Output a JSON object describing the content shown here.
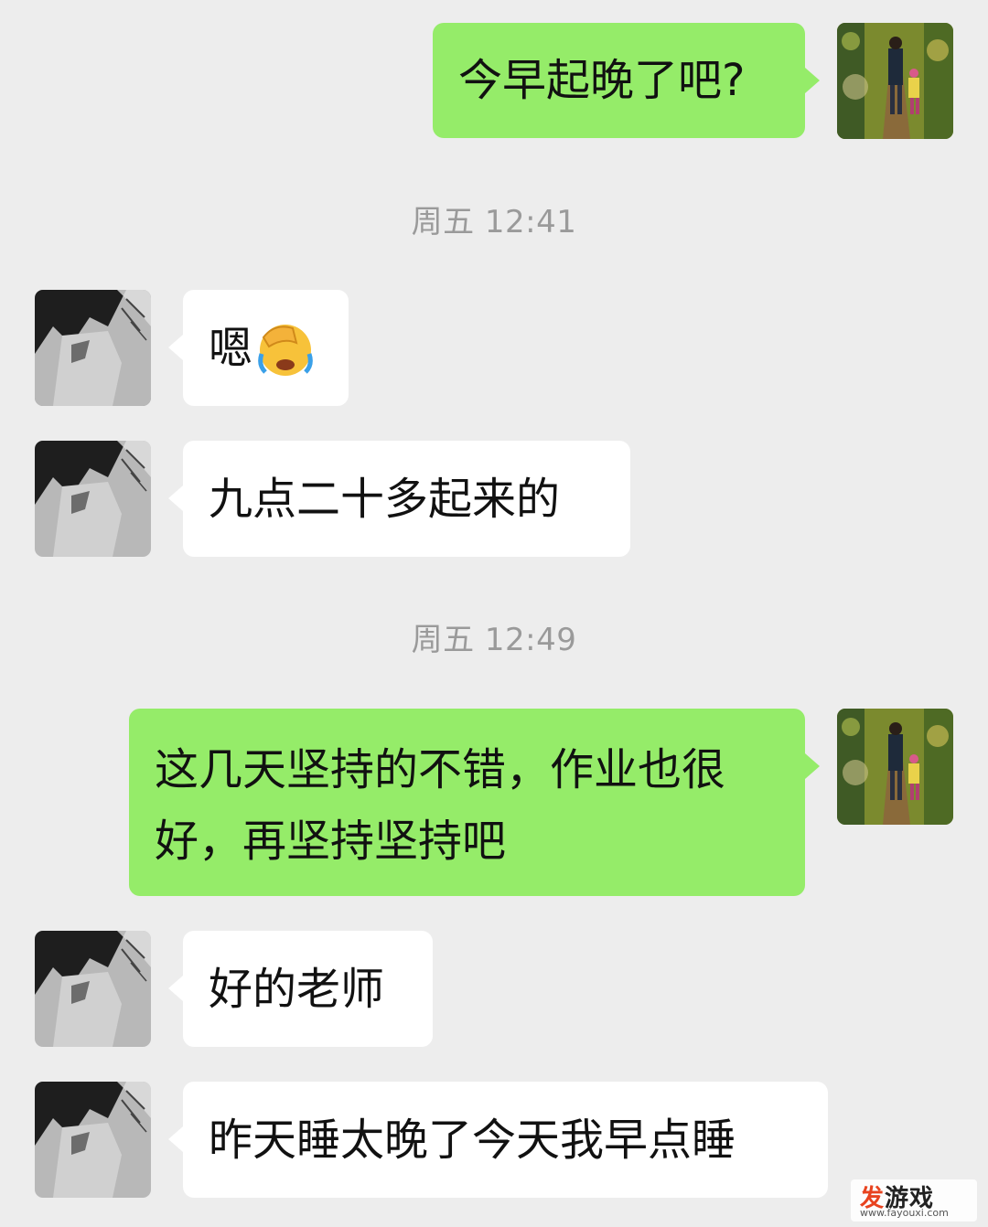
{
  "messages": [
    {
      "side": "out",
      "text": "今早起晚了吧?"
    },
    {
      "side": "in",
      "text": "嗯",
      "emoji": "face-palm-crying-emoji"
    },
    {
      "side": "in",
      "text": "九点二十多起来的"
    },
    {
      "side": "out",
      "text_line1": "这几天坚持的不错，作业也很",
      "text_line2": "好，再坚持坚持吧"
    },
    {
      "side": "in",
      "text": "好的老师"
    },
    {
      "side": "in",
      "text": "昨天睡太晚了今天我早点睡"
    }
  ],
  "timestamps": [
    "周五 12:41",
    "周五 12:49"
  ],
  "avatars": {
    "self": "forest-path-family-avatar",
    "contact": "anime-boy-grayscale-avatar"
  },
  "watermark": {
    "accent": "发",
    "main": "游戏",
    "sub": "www.fayouxi.com"
  },
  "colors": {
    "background": "#ededed",
    "outgoing_bubble": "#95ec69",
    "incoming_bubble": "#ffffff",
    "timestamp_text": "#9a9a9a"
  }
}
